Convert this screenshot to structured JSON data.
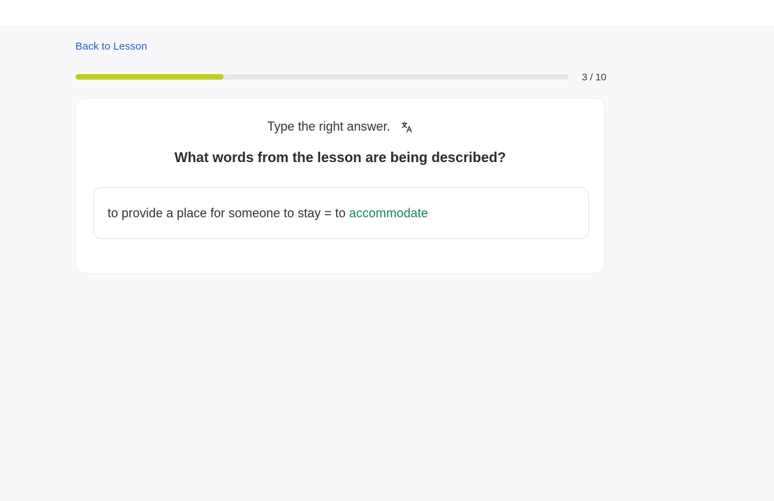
{
  "nav": {
    "back_label": "Back to Lesson"
  },
  "progress": {
    "current": 3,
    "total": 10,
    "fraction": 0.3,
    "label": "3 / 10",
    "fill_color": "#bcd11f"
  },
  "exercise": {
    "instruction": "Type the right answer.",
    "translate_icon": "translate-icon",
    "question": "What words from the lesson are being described?",
    "prompt": "to provide a place for someone to stay = to",
    "answer": "accommodate",
    "answer_color": "#17845a"
  }
}
